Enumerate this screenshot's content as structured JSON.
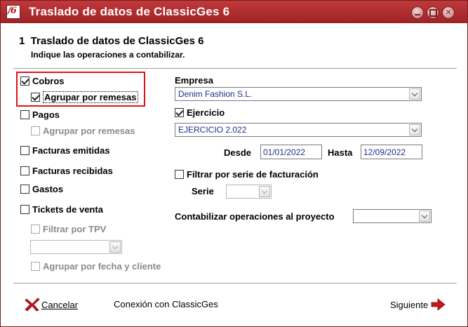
{
  "window": {
    "title": "Traslado de datos de ClassicGes 6",
    "icon_glyph": "/6"
  },
  "header": {
    "title": "1  Traslado de datos de ClassicGes 6",
    "subtitle": "Indique las operaciones a contabilizar."
  },
  "left": {
    "cobros": {
      "label": "Cobros",
      "checked": true
    },
    "cobros_agrupar": {
      "label": "Agrupar por remesas",
      "checked": true
    },
    "pagos": {
      "label": "Pagos",
      "checked": false
    },
    "pagos_agrupar": {
      "label": "Agrupar por remesas",
      "checked": false,
      "enabled": false
    },
    "facturas_emitidas": {
      "label": "Facturas emitidas",
      "checked": false
    },
    "facturas_recibidas": {
      "label": "Facturas recibidas",
      "checked": false
    },
    "gastos": {
      "label": "Gastos",
      "checked": false
    },
    "tickets": {
      "label": "Tickets de venta",
      "checked": false
    },
    "filtrar_tpv": {
      "label": "Filtrar por TPV",
      "checked": false,
      "enabled": false
    },
    "tpv_select": {
      "value": ""
    },
    "agrupar_fecha_cliente": {
      "label": "Agrupar por fecha y cliente",
      "checked": false,
      "enabled": false
    }
  },
  "right": {
    "empresa_label": "Empresa",
    "empresa_value": "Denim Fashion S.L.",
    "ejercicio": {
      "label": "Ejercicio",
      "checked": true
    },
    "ejercicio_value": "EJERCICIO 2.022",
    "desde_label": "Desde",
    "desde_value": "01/01/2022",
    "hasta_label": "Hasta",
    "hasta_value": "12/09/2022",
    "filtrar_serie": {
      "label": "Filtrar por serie de facturación",
      "checked": false
    },
    "serie_label": "Serie",
    "serie_value": "",
    "proyecto_label": "Contabilizar operaciones al proyecto",
    "proyecto_value": ""
  },
  "footer": {
    "cancel_label": "Cancelar",
    "connection_label": "Conexión con ClassicGes",
    "next_label": "Siguiente"
  },
  "colors": {
    "titlebar": "#b02d2f",
    "highlight": "#e0141a",
    "value_text": "#1f2f8f"
  },
  "icons": {
    "cancel": "red-x-icon",
    "next": "red-arrow-right-icon"
  }
}
